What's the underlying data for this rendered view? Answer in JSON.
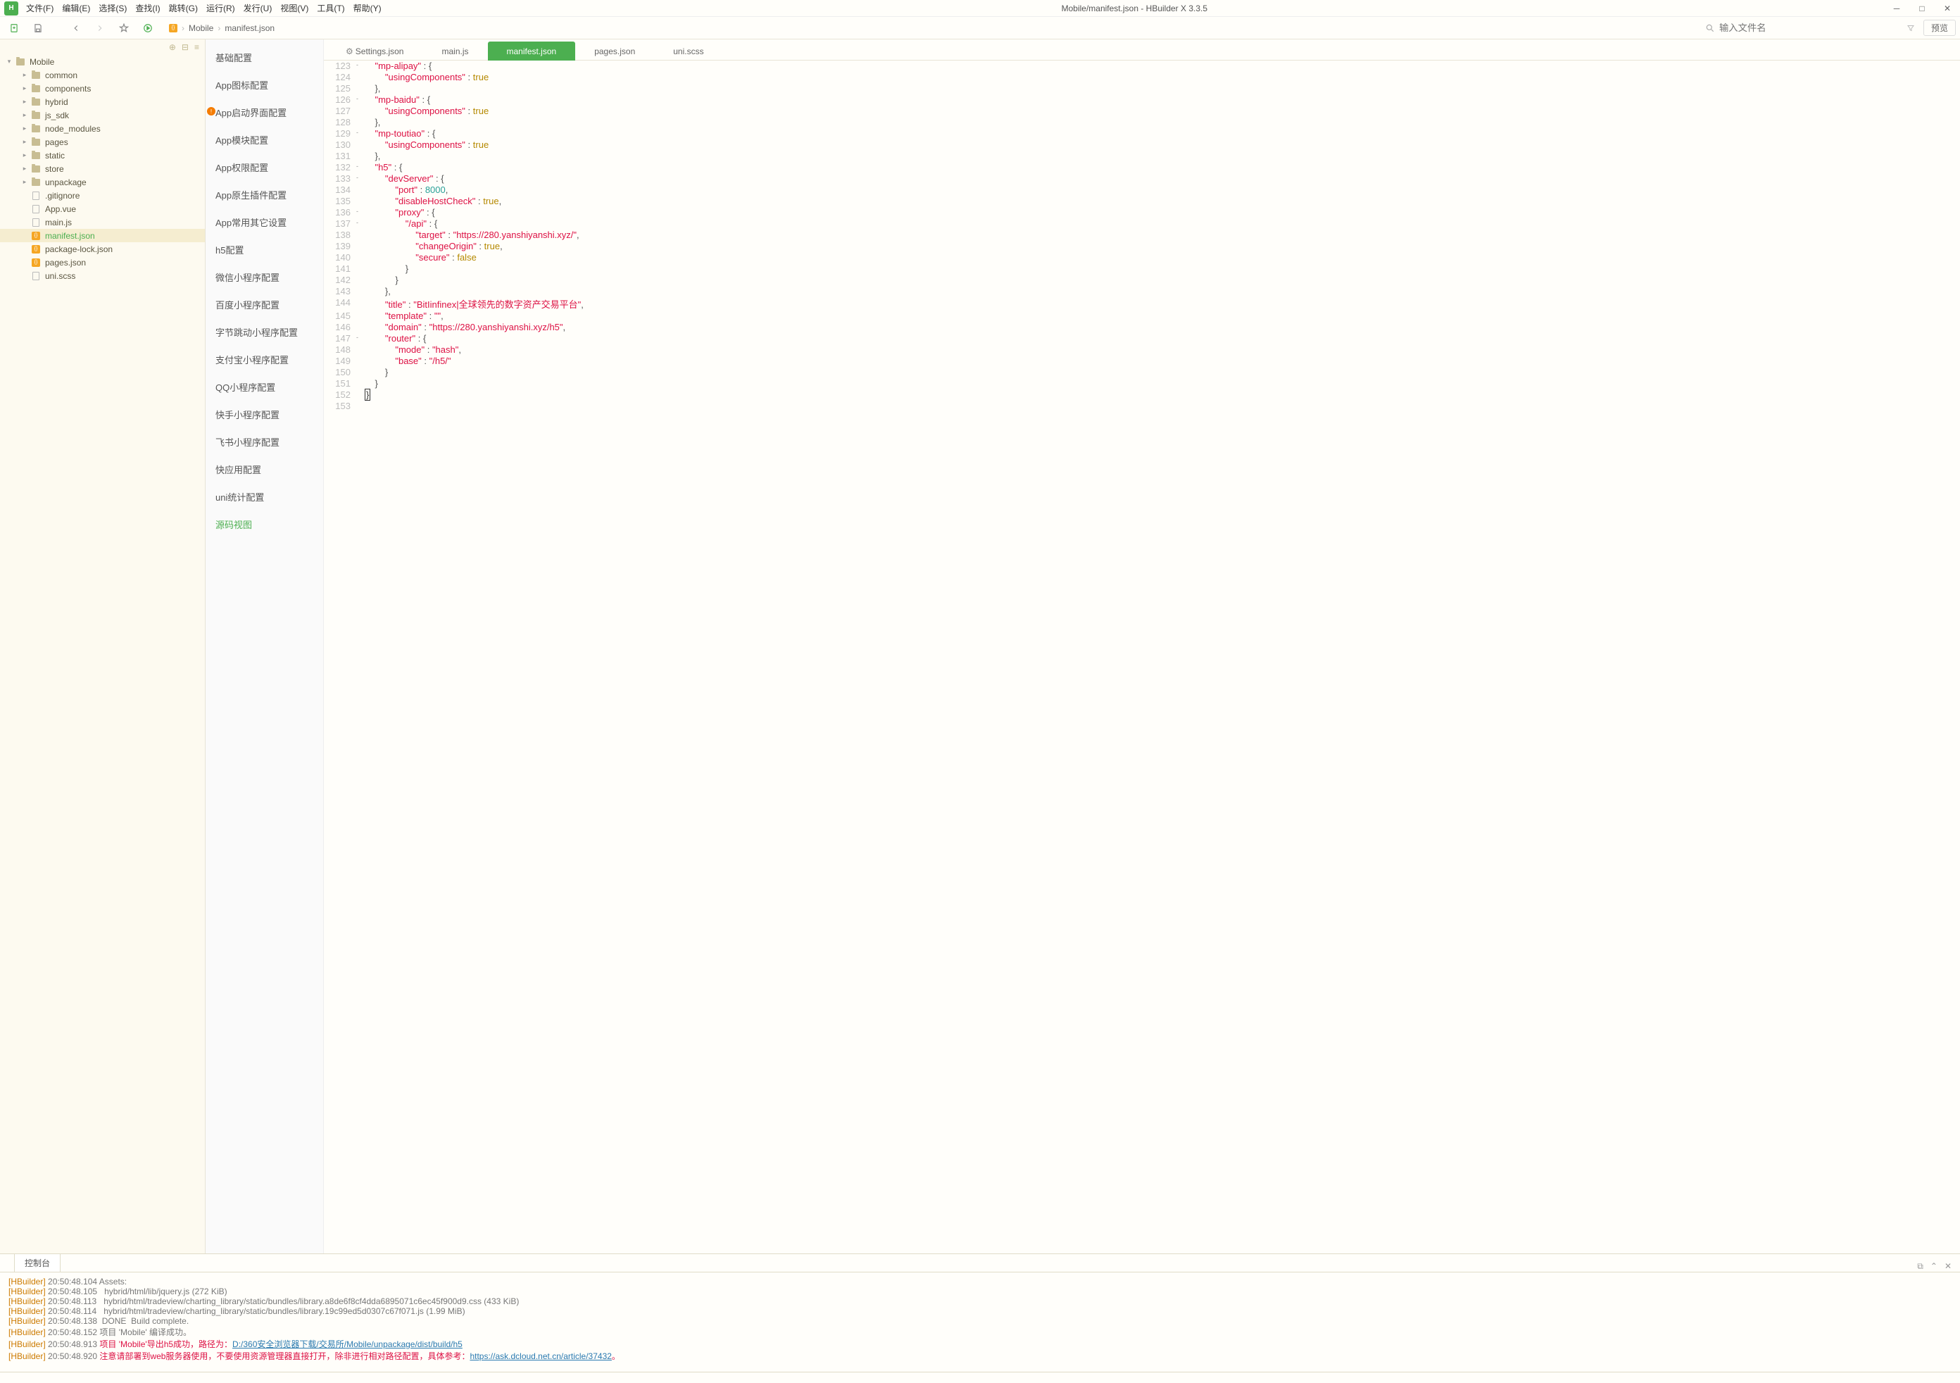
{
  "titlebar": {
    "title": "Mobile/manifest.json - HBuilder X 3.3.5"
  },
  "menu": [
    "文件(F)",
    "编辑(E)",
    "选择(S)",
    "查找(I)",
    "跳转(G)",
    "运行(R)",
    "发行(U)",
    "视图(V)",
    "工具(T)",
    "帮助(Y)"
  ],
  "breadcrumb": {
    "root": "Mobile",
    "file": "manifest.json"
  },
  "search": {
    "placeholder": "输入文件名"
  },
  "preview_label": "预览",
  "tree": {
    "root": "Mobile",
    "folders": [
      "common",
      "components",
      "hybrid",
      "js_sdk",
      "node_modules",
      "pages",
      "static",
      "store",
      "unpackage"
    ],
    "files": [
      ".gitignore",
      "App.vue",
      "main.js",
      "manifest.json",
      "package-lock.json",
      "pages.json",
      "uni.scss"
    ],
    "selected": "manifest.json"
  },
  "confignav": [
    {
      "label": "基础配置"
    },
    {
      "label": "App图标配置"
    },
    {
      "label": "App启动界面配置",
      "warn": true
    },
    {
      "label": "App模块配置"
    },
    {
      "label": "App权限配置"
    },
    {
      "label": "App原生插件配置"
    },
    {
      "label": "App常用其它设置"
    },
    {
      "label": "h5配置"
    },
    {
      "label": "微信小程序配置"
    },
    {
      "label": "百度小程序配置"
    },
    {
      "label": "字节跳动小程序配置"
    },
    {
      "label": "支付宝小程序配置"
    },
    {
      "label": "QQ小程序配置"
    },
    {
      "label": "快手小程序配置"
    },
    {
      "label": "飞书小程序配置"
    },
    {
      "label": "快应用配置"
    },
    {
      "label": "uni统计配置"
    },
    {
      "label": "源码视图",
      "act": true
    }
  ],
  "tabs": [
    {
      "label": "Settings.json",
      "gear": true
    },
    {
      "label": "main.js"
    },
    {
      "label": "manifest.json",
      "act": true
    },
    {
      "label": "pages.json"
    },
    {
      "label": "uni.scss"
    }
  ],
  "code": {
    "start": 123,
    "lines": [
      {
        "n": 123,
        "f": "-",
        "t": "    \"mp-alipay\" : {",
        "seg": [
          [
            "p",
            "    "
          ],
          [
            "k",
            "\"mp-alipay\""
          ],
          [
            "p",
            " : {"
          ]
        ]
      },
      {
        "n": 124,
        "t": "        \"usingComponents\" : true",
        "seg": [
          [
            "p",
            "        "
          ],
          [
            "k",
            "\"usingComponents\""
          ],
          [
            "p",
            " : "
          ],
          [
            "b",
            "true"
          ]
        ]
      },
      {
        "n": 125,
        "t": "    },",
        "seg": [
          [
            "p",
            "    },"
          ]
        ]
      },
      {
        "n": 126,
        "f": "-",
        "seg": [
          [
            "p",
            "    "
          ],
          [
            "k",
            "\"mp-baidu\""
          ],
          [
            "p",
            " : {"
          ]
        ]
      },
      {
        "n": 127,
        "seg": [
          [
            "p",
            "        "
          ],
          [
            "k",
            "\"usingComponents\""
          ],
          [
            "p",
            " : "
          ],
          [
            "b",
            "true"
          ]
        ]
      },
      {
        "n": 128,
        "seg": [
          [
            "p",
            "    },"
          ]
        ]
      },
      {
        "n": 129,
        "f": "-",
        "seg": [
          [
            "p",
            "    "
          ],
          [
            "k",
            "\"mp-toutiao\""
          ],
          [
            "p",
            " : {"
          ]
        ]
      },
      {
        "n": 130,
        "seg": [
          [
            "p",
            "        "
          ],
          [
            "k",
            "\"usingComponents\""
          ],
          [
            "p",
            " : "
          ],
          [
            "b",
            "true"
          ]
        ]
      },
      {
        "n": 131,
        "seg": [
          [
            "p",
            "    },"
          ]
        ]
      },
      {
        "n": 132,
        "f": "-",
        "seg": [
          [
            "p",
            "    "
          ],
          [
            "k",
            "\"h5\""
          ],
          [
            "p",
            " : {"
          ]
        ]
      },
      {
        "n": 133,
        "f": "-",
        "seg": [
          [
            "p",
            "        "
          ],
          [
            "k",
            "\"devServer\""
          ],
          [
            "p",
            " : {"
          ]
        ]
      },
      {
        "n": 134,
        "seg": [
          [
            "p",
            "            "
          ],
          [
            "k",
            "\"port\""
          ],
          [
            "p",
            " : "
          ],
          [
            "l",
            "8000"
          ],
          [
            "p",
            ","
          ]
        ]
      },
      {
        "n": 135,
        "seg": [
          [
            "p",
            "            "
          ],
          [
            "k",
            "\"disableHostCheck\""
          ],
          [
            "p",
            " : "
          ],
          [
            "b",
            "true"
          ],
          [
            "p",
            ","
          ]
        ]
      },
      {
        "n": 136,
        "f": "-",
        "seg": [
          [
            "p",
            "            "
          ],
          [
            "k",
            "\"proxy\""
          ],
          [
            "p",
            " : {"
          ]
        ]
      },
      {
        "n": 137,
        "f": "-",
        "seg": [
          [
            "p",
            "                "
          ],
          [
            "k",
            "\"/api\""
          ],
          [
            "p",
            " : {"
          ]
        ]
      },
      {
        "n": 138,
        "seg": [
          [
            "p",
            "                    "
          ],
          [
            "k",
            "\"target\""
          ],
          [
            "p",
            " : "
          ],
          [
            "s",
            "\"https://280.yanshiyanshi.xyz/\""
          ],
          [
            "p",
            ","
          ]
        ]
      },
      {
        "n": 139,
        "seg": [
          [
            "p",
            "                    "
          ],
          [
            "k",
            "\"changeOrigin\""
          ],
          [
            "p",
            " : "
          ],
          [
            "b",
            "true"
          ],
          [
            "p",
            ","
          ]
        ]
      },
      {
        "n": 140,
        "seg": [
          [
            "p",
            "                    "
          ],
          [
            "k",
            "\"secure\""
          ],
          [
            "p",
            " : "
          ],
          [
            "b",
            "false"
          ]
        ]
      },
      {
        "n": 141,
        "seg": [
          [
            "p",
            "                }"
          ]
        ]
      },
      {
        "n": 142,
        "seg": [
          [
            "p",
            "            }"
          ]
        ]
      },
      {
        "n": 143,
        "seg": [
          [
            "p",
            "        },"
          ]
        ]
      },
      {
        "n": 144,
        "seg": [
          [
            "p",
            "        "
          ],
          [
            "k",
            "\"title\""
          ],
          [
            "p",
            " : "
          ],
          [
            "s",
            "\"BitIinfinex|全球领先的数字资产交易平台\""
          ],
          [
            "p",
            ","
          ]
        ]
      },
      {
        "n": 145,
        "seg": [
          [
            "p",
            "        "
          ],
          [
            "k",
            "\"template\""
          ],
          [
            "p",
            " : "
          ],
          [
            "s",
            "\"\""
          ],
          [
            "p",
            ","
          ]
        ]
      },
      {
        "n": 146,
        "seg": [
          [
            "p",
            "        "
          ],
          [
            "k",
            "\"domain\""
          ],
          [
            "p",
            " : "
          ],
          [
            "s",
            "\"https://280.yanshiyanshi.xyz/h5\""
          ],
          [
            "p",
            ","
          ]
        ]
      },
      {
        "n": 147,
        "f": "-",
        "seg": [
          [
            "p",
            "        "
          ],
          [
            "k",
            "\"router\""
          ],
          [
            "p",
            " : {"
          ]
        ]
      },
      {
        "n": 148,
        "seg": [
          [
            "p",
            "            "
          ],
          [
            "k",
            "\"mode\""
          ],
          [
            "p",
            " : "
          ],
          [
            "s",
            "\"hash\""
          ],
          [
            "p",
            ","
          ]
        ]
      },
      {
        "n": 149,
        "seg": [
          [
            "p",
            "            "
          ],
          [
            "k",
            "\"base\""
          ],
          [
            "p",
            " : "
          ],
          [
            "s",
            "\"/h5/\""
          ]
        ]
      },
      {
        "n": 150,
        "seg": [
          [
            "p",
            "        }"
          ]
        ]
      },
      {
        "n": 151,
        "seg": [
          [
            "p",
            "    }"
          ]
        ]
      },
      {
        "n": 152,
        "seg": [
          [
            "c",
            "}"
          ]
        ]
      },
      {
        "n": 153,
        "seg": [
          [
            "p",
            ""
          ]
        ]
      }
    ]
  },
  "console": {
    "tab": "控制台",
    "rows": [
      {
        "seg": [
          [
            "tag",
            "[HBuilder]"
          ],
          [
            "ts",
            " 20:50:48.104 "
          ],
          [
            "ok",
            "Assets:"
          ]
        ]
      },
      {
        "seg": [
          [
            "tag",
            "[HBuilder]"
          ],
          [
            "ts",
            " 20:50:48.105   "
          ],
          [
            "ok",
            "hybrid/html/lib/jquery.js (272 KiB)"
          ]
        ]
      },
      {
        "seg": [
          [
            "tag",
            "[HBuilder]"
          ],
          [
            "ts",
            " 20:50:48.113   "
          ],
          [
            "ok",
            "hybrid/html/tradeview/charting_library/static/bundles/library.a8de6f8cf4dda6895071c6ec45f900d9.css (433 KiB)"
          ]
        ]
      },
      {
        "seg": [
          [
            "tag",
            "[HBuilder]"
          ],
          [
            "ts",
            " 20:50:48.114   "
          ],
          [
            "ok",
            "hybrid/html/tradeview/charting_library/static/bundles/library.19c99ed5d0307c67f071.js (1.99 MiB)"
          ]
        ]
      },
      {
        "seg": [
          [
            "tag",
            "[HBuilder]"
          ],
          [
            "ts",
            " 20:50:48.138  "
          ],
          [
            "ok",
            "DONE  Build complete."
          ]
        ]
      },
      {
        "seg": [
          [
            "tag",
            "[HBuilder]"
          ],
          [
            "ts",
            " 20:50:48.152 "
          ],
          [
            "ok",
            "项目 'Mobile' 编译成功。"
          ]
        ]
      },
      {
        "seg": [
          [
            "tag",
            "[HBuilder]"
          ],
          [
            "ts",
            " 20:50:48.913 "
          ],
          [
            "red",
            "项目 'Mobile'导出h5成功，路径为："
          ],
          [
            "lnk",
            "D:/360安全浏览器下载/交易所/Mobile/unpackage/dist/build/h5"
          ]
        ]
      },
      {
        "seg": [
          [
            "tag",
            "[HBuilder]"
          ],
          [
            "ts",
            " 20:50:48.920 "
          ],
          [
            "red",
            "注意请部署到web服务器使用，不要使用资源管理器直接打开，除非进行相对路径配置，具体参考："
          ],
          [
            "lnk",
            "https://ask.dcloud.net.cn/article/37432"
          ],
          [
            "red",
            "。"
          ]
        ]
      }
    ]
  }
}
